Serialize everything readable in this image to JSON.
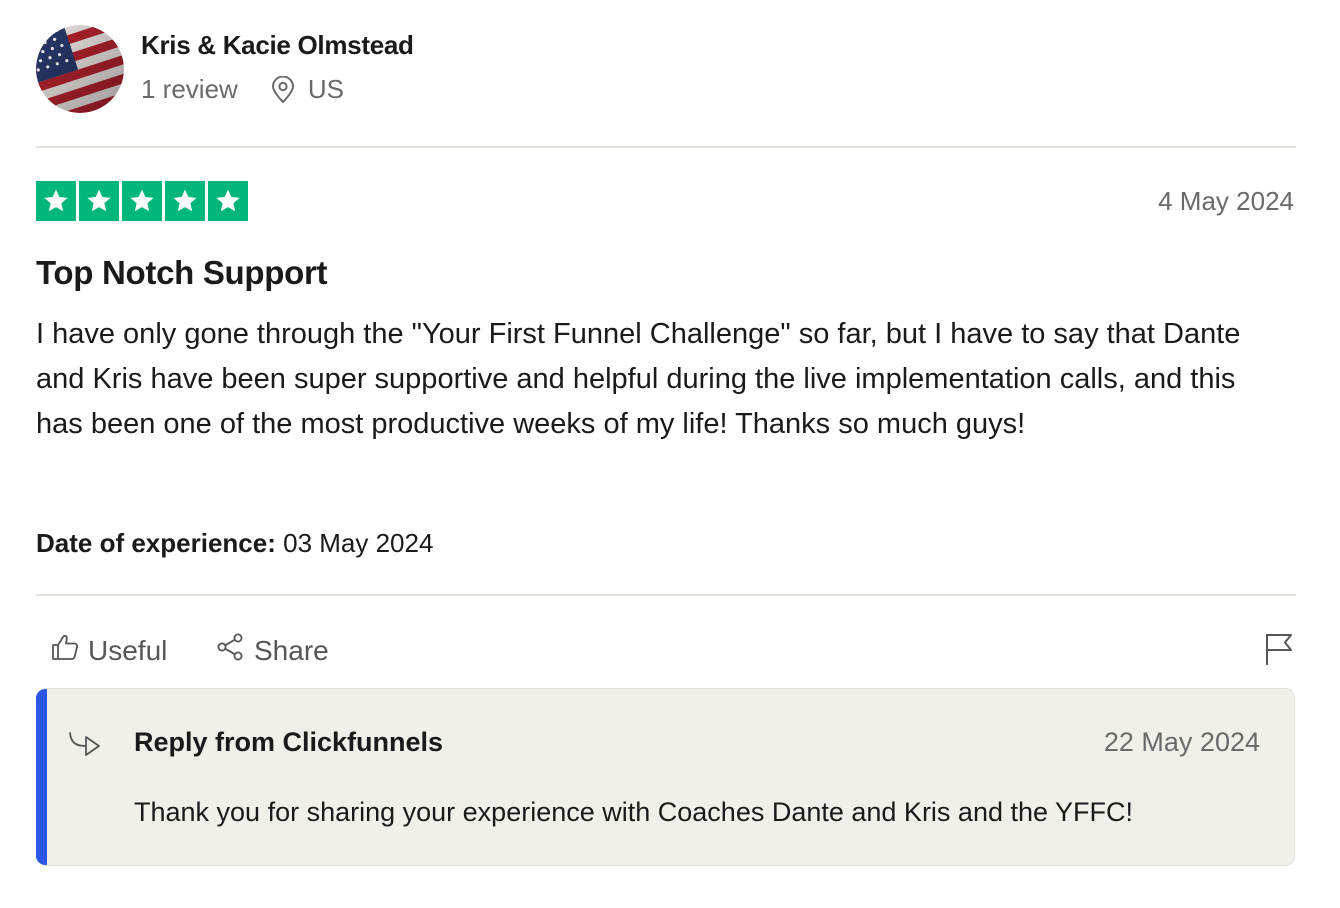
{
  "consumer": {
    "name": "Kris & Kacie Olmstead",
    "review_count": "1 review",
    "country": "US",
    "avatar_icon": "us-flag-avatar",
    "location_icon": "location-pin-icon"
  },
  "review": {
    "rating": 5,
    "rating_max": 5,
    "star_color": "#00b67a",
    "date": "4 May 2024",
    "title": "Top Notch Support",
    "text": "I have only gone through the \"Your First Funnel Challenge\" so far, but I have to say that Dante and Kris have been super supportive and helpful during the live implementation calls, and this has been one of the most productive weeks of my life! Thanks so much guys!",
    "experience_label": "Date of experience:",
    "experience_date": "03 May 2024"
  },
  "actions": {
    "useful_label": "Useful",
    "share_label": "Share",
    "useful_icon": "thumbs-up-icon",
    "share_icon": "share-icon",
    "flag_icon": "flag-icon"
  },
  "reply": {
    "title": "Reply from Clickfunnels",
    "date": "22 May 2024",
    "text": "Thank you for sharing your experience with Coaches Dante and Kris and the YFFC!",
    "accent_color": "#2b57e6",
    "icon": "reply-arrow-icon"
  }
}
